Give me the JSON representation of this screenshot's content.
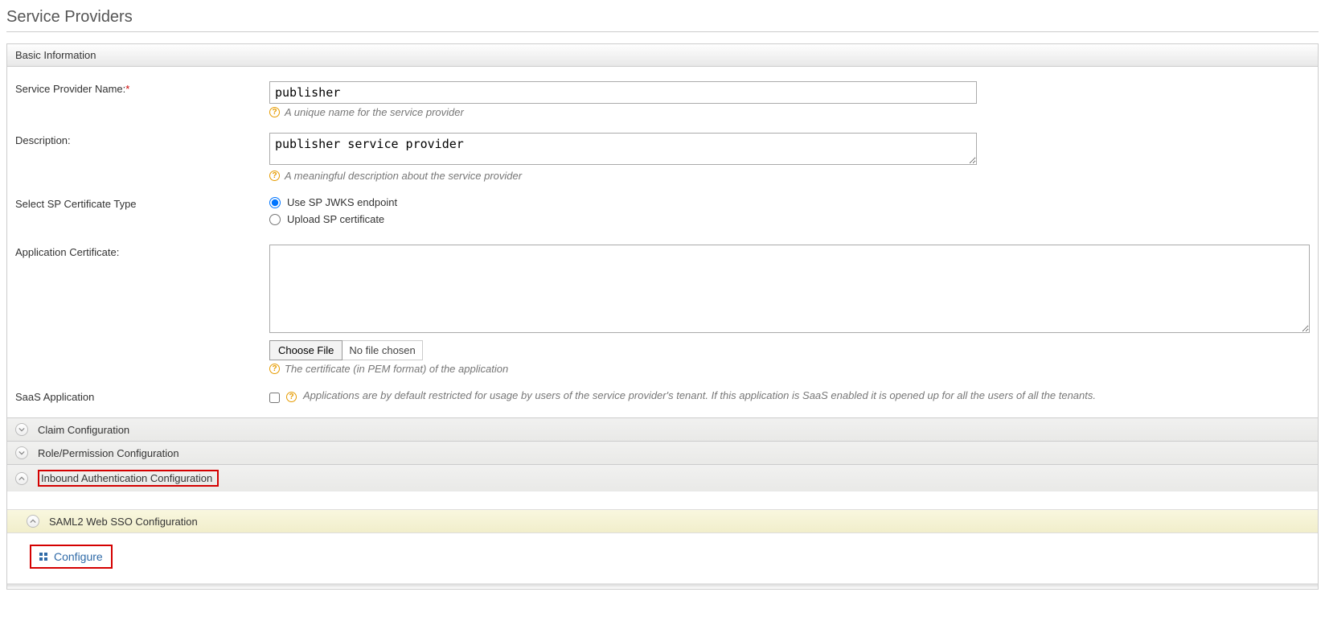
{
  "page": {
    "title": "Service Providers"
  },
  "basic": {
    "title": "Basic Information",
    "spName": {
      "label": "Service Provider Name:",
      "value": "publisher",
      "help": "A unique name for the service provider"
    },
    "description": {
      "label": "Description:",
      "value": "publisher service provider",
      "help": "A meaningful description about the service provider"
    },
    "certType": {
      "label": "Select SP Certificate Type",
      "opt1": "Use SP JWKS endpoint",
      "opt2": "Upload SP certificate"
    },
    "appCert": {
      "label": "Application Certificate:",
      "chooseFile": "Choose File",
      "noFile": "No file chosen",
      "help": "The certificate (in PEM format) of the application"
    },
    "saas": {
      "label": "SaaS Application",
      "help": "Applications are by default restricted for usage by users of the service provider's tenant. If this application is SaaS enabled it is opened up for all the users of all the tenants."
    }
  },
  "accordions": {
    "claim": "Claim Configuration",
    "role": "Role/Permission Configuration",
    "inbound": "Inbound Authentication Configuration",
    "saml2": "SAML2 Web SSO Configuration",
    "configure": "Configure"
  }
}
